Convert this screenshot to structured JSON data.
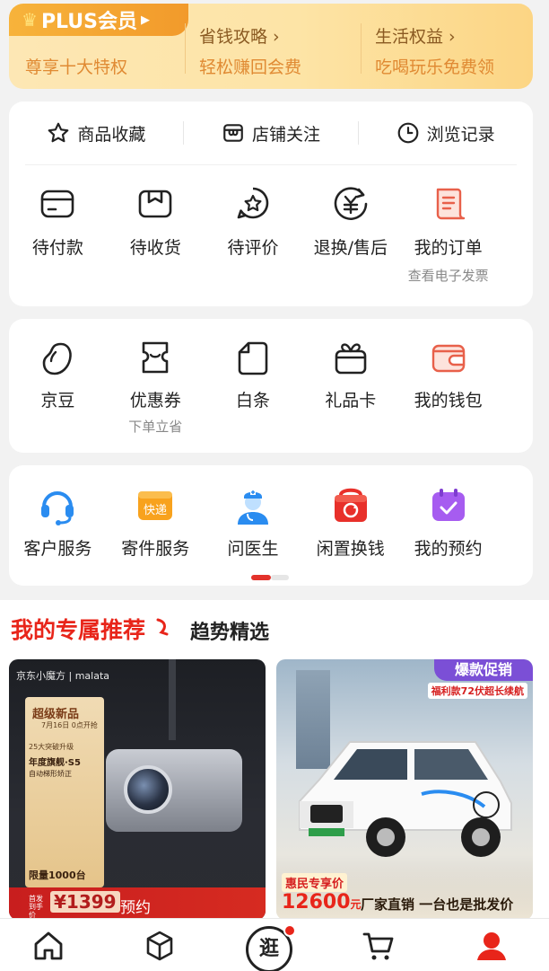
{
  "plus": {
    "badge": "PLUS会员",
    "subtitle": "尊享十大特权",
    "items": [
      {
        "title": "省钱攻略",
        "desc": "轻松赚回会费"
      },
      {
        "title": "生活权益",
        "desc": "吃喝玩乐免费领"
      }
    ]
  },
  "quick_links": [
    {
      "label": "商品收藏",
      "icon": "star-icon"
    },
    {
      "label": "店铺关注",
      "icon": "store-icon"
    },
    {
      "label": "浏览记录",
      "icon": "clock-icon"
    }
  ],
  "orders": [
    {
      "label": "待付款",
      "icon": "wallet-card-icon"
    },
    {
      "label": "待收货",
      "icon": "package-box-icon"
    },
    {
      "label": "待评价",
      "icon": "review-star-icon"
    },
    {
      "label": "退换/售后",
      "icon": "refund-yen-icon"
    },
    {
      "label": "我的订单",
      "icon": "order-doc-icon",
      "sub": "查看电子发票"
    }
  ],
  "assets": [
    {
      "label": "京豆",
      "icon": "bean-icon"
    },
    {
      "label": "优惠券",
      "icon": "coupon-icon",
      "sub": "下单立省"
    },
    {
      "label": "白条",
      "icon": "baitiao-icon"
    },
    {
      "label": "礼品卡",
      "icon": "gift-card-icon"
    },
    {
      "label": "我的钱包",
      "icon": "wallet-icon"
    }
  ],
  "services": [
    {
      "label": "客户服务",
      "icon": "headset-icon"
    },
    {
      "label": "寄件服务",
      "icon": "express-icon",
      "icon_text": "快递"
    },
    {
      "label": "问医生",
      "icon": "doctor-icon"
    },
    {
      "label": "闲置换钱",
      "icon": "recycle-icon"
    },
    {
      "label": "我的预约",
      "icon": "calendar-check-icon"
    }
  ],
  "services_page": {
    "current": 1,
    "total": 2
  },
  "recommend": {
    "title": "我的专属推荐",
    "trend": "趋势精选"
  },
  "products": [
    {
      "brand": "京东小魔方 | malata",
      "headline": "超级新品",
      "date": "7月16日 0点开抢",
      "lines": [
        "25大突破升级",
        "年度旗舰·S5",
        "自动梯形矫正"
      ],
      "quantity": "限量1000台",
      "presale": "首发到手价",
      "price": "1399",
      "action": "预约"
    },
    {
      "tag": "爆款促销",
      "promo": "福利款72伏超长续航",
      "label": "惠民专享价",
      "price": "12600",
      "unit": "元",
      "slogan": "厂家直销 一台也是批发价"
    }
  ],
  "tabbar": [
    {
      "name": "home",
      "icon": "home-icon"
    },
    {
      "name": "category",
      "icon": "cube-icon"
    },
    {
      "name": "discover",
      "icon": "guang-icon",
      "text": "逛",
      "has_badge": true
    },
    {
      "name": "cart",
      "icon": "cart-icon"
    },
    {
      "name": "me",
      "icon": "user-icon",
      "active": true
    }
  ],
  "colors": {
    "accent": "#e8251a",
    "plus_gold": "#f29a2b"
  }
}
